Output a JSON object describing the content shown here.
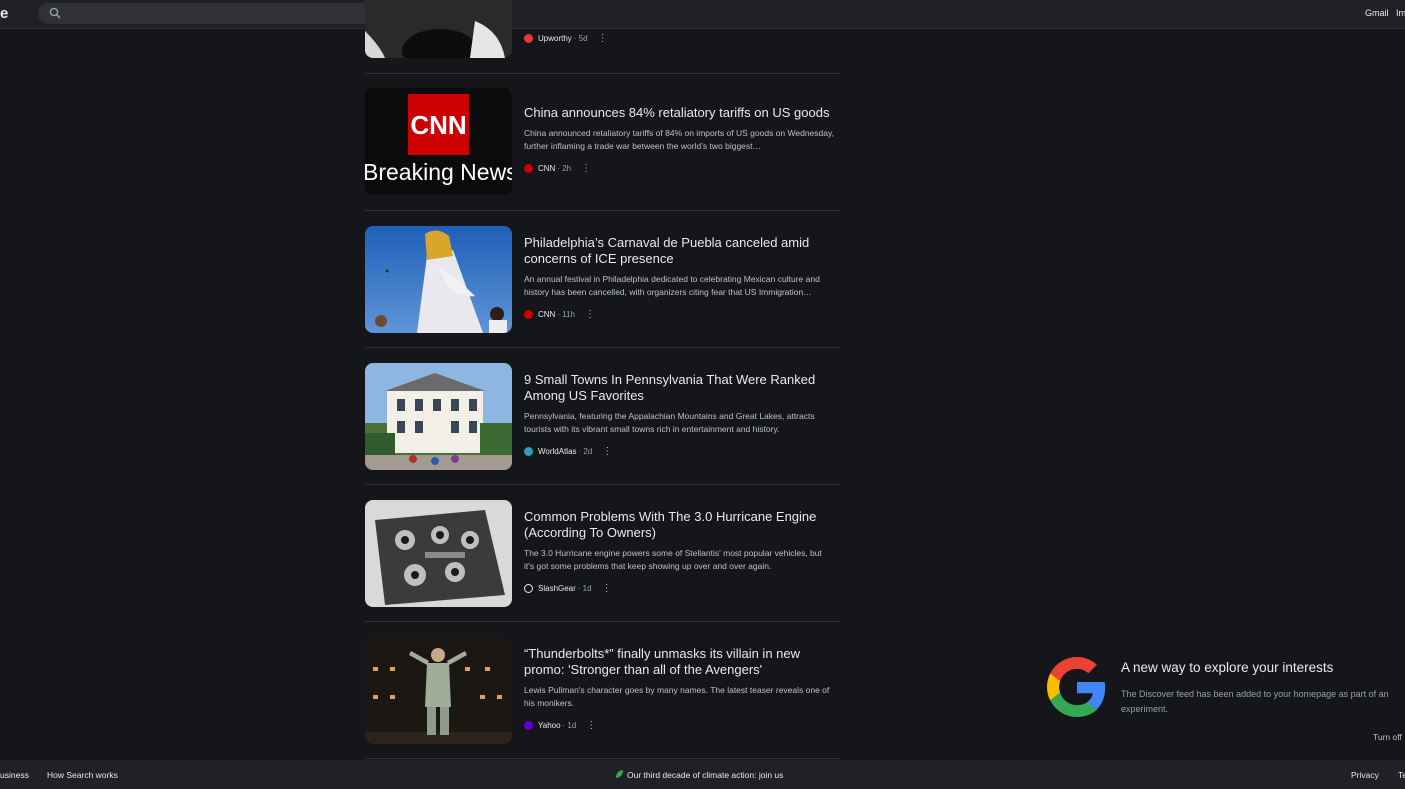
{
  "header": {
    "logo_fragment": "e",
    "search": {
      "value": "",
      "placeholder": ""
    },
    "links": [
      "Gmail",
      "Im"
    ]
  },
  "feed": {
    "partial_card": {
      "source": "Upworthy",
      "age": "· 5d",
      "more": "⋮"
    },
    "cards": [
      {
        "title": "China announces 84% retaliatory tariffs on US goods",
        "snippet": "China announced retaliatory tariffs of 84% on imports of US goods on Wednesday, further inflaming a trade war between the world’s two biggest…",
        "source": "CNN",
        "age": "· 2h",
        "thumb_text_logo": "CNN",
        "thumb_text_caption": "Breaking News",
        "source_color": "#cc0000"
      },
      {
        "title": "Philadelphia’s Carnaval de Puebla canceled amid concerns of ICE presence",
        "snippet": "An annual festival in Philadelphia dedicated to celebrating Mexican culture and history has been cancelled, with organizers citing fear that US Immigration…",
        "source": "CNN",
        "age": "· 11h",
        "source_color": "#cc0000"
      },
      {
        "title": "9 Small Towns In Pennsylvania That Were Ranked Among US Favorites",
        "snippet": "Pennsylvania, featuring the Appalachian Mountains and Great Lakes, attracts tourists with its vibrant small towns rich in entertainment and history.",
        "source": "WorldAtlas",
        "age": "· 2d",
        "source_color": "#2a9fb8"
      },
      {
        "title": "Common Problems With The 3.0 Hurricane Engine (According To Owners)",
        "snippet": "The 3.0 Hurricane engine powers some of Stellantis' most popular vehicles, but it's got some problems that keep showing up over and over again.",
        "source": "SlashGear",
        "age": "· 1d",
        "source_color": "#e8eaed"
      },
      {
        "title": "“Thunderbolts*” finally unmasks its villain in new promo: 'Stronger than all of the Avengers'",
        "snippet": "Lewis Pullman's character goes by many names. The latest teaser reveals one of his monikers.",
        "source": "Yahoo",
        "age": "· 1d",
        "source_color": "#6001d2"
      }
    ]
  },
  "promo": {
    "title": "A new way to explore your interests",
    "body": "The Discover feed has been added to your homepage as part of an experiment.",
    "turn_off": "Turn off"
  },
  "footer": {
    "business": "usiness",
    "how_search_works": "How Search works",
    "climate": "Our third decade of climate action: join us",
    "privacy": "Privacy",
    "terms": "Te"
  }
}
